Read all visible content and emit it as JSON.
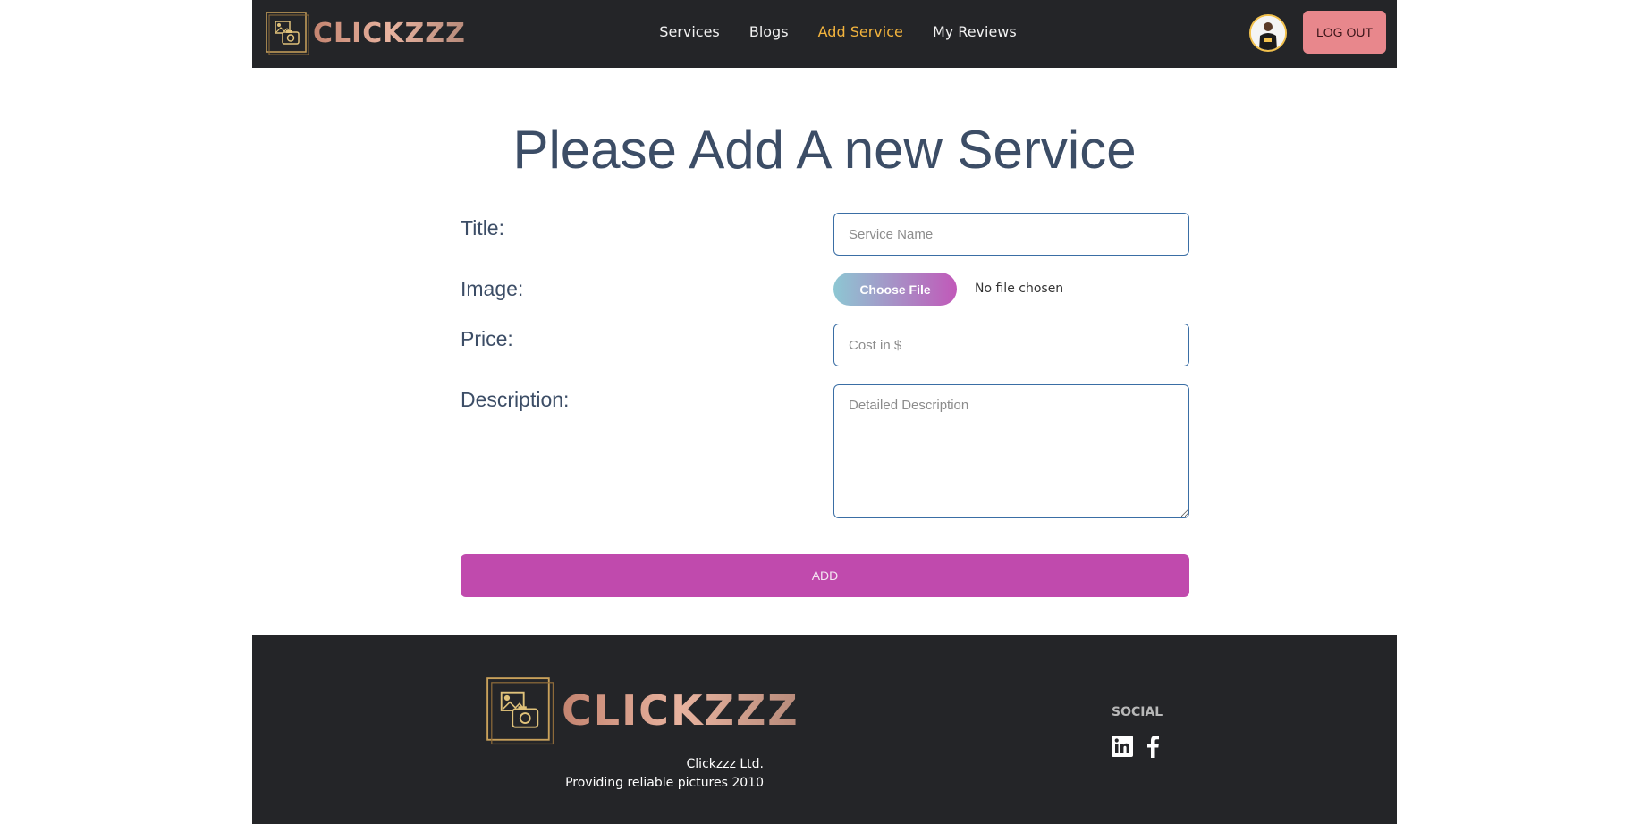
{
  "brand": {
    "name": "CLICKZZZ"
  },
  "nav": {
    "links": [
      {
        "label": "Services"
      },
      {
        "label": "Blogs"
      },
      {
        "label": "Add Service"
      },
      {
        "label": "My Reviews"
      }
    ],
    "active": "Add Service",
    "logout_label": "LOG OUT"
  },
  "form": {
    "heading": "Please Add A new Service",
    "title_label": "Title:",
    "title_placeholder": "Service Name",
    "title_value": "",
    "image_label": "Image:",
    "choose_file_label": "Choose File",
    "file_status": "No file chosen",
    "price_label": "Price:",
    "price_placeholder": "Cost in $",
    "price_value": "",
    "description_label": "Description:",
    "description_placeholder": "Detailed Description",
    "description_value": "",
    "submit_label": "ADD"
  },
  "footer": {
    "company": "Clickzzz Ltd.",
    "tagline": "Providing reliable pictures 2010",
    "social_heading": "SOCIAL",
    "social_icons": [
      "linkedin-icon",
      "facebook-icon"
    ]
  },
  "colors": {
    "nav_bg": "#242528",
    "active_link": "#f2b33d",
    "logout_bg": "#e8878c",
    "heading": "#3c4d66",
    "add_button": "#c04aad",
    "input_border": "#3a6ea5"
  }
}
